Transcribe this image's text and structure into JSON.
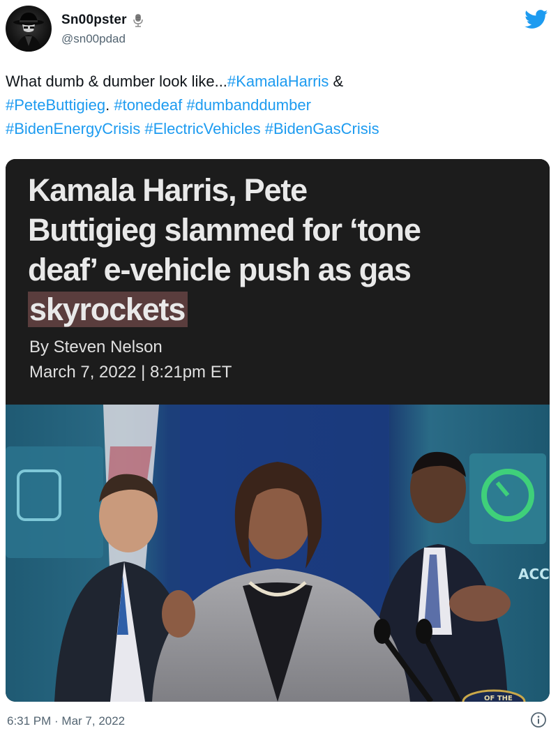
{
  "author": {
    "display_name": "Sn00pster",
    "handle": "@sn00pdad",
    "avatar_icon": "detective-hat-avatar",
    "badge_icon": "microphone-icon"
  },
  "brand": {
    "logo_icon": "twitter-bird-icon",
    "color": "#1d9bf0"
  },
  "tweet": {
    "text_plain_1": "What dumb & dumber look like...",
    "hashtag_kamala": "#KamalaHarris",
    "amp": " & ",
    "hashtag_pete": "#PeteButtigieg",
    "period": ". ",
    "hashtag_tonedeaf": "#tonedeaf",
    "hashtag_dumb": "#dumbanddumber",
    "hashtag_biden_energy": "#BidenEnergyCrisis",
    "hashtag_ev": "#ElectricVehicles",
    "hashtag_biden_gas": "#BidenGasCrisis"
  },
  "article": {
    "headline_line1": "Kamala Harris, Pete",
    "headline_line2": "Buttigieg slammed for ‘tone",
    "headline_line3": "deaf’ e-vehicle push as gas",
    "headline_highlight": "skyrockets",
    "byline": "By Steven Nelson",
    "dateline": "March 7, 2022 | 8:21pm ET",
    "photo_sign_text": "ACC",
    "seal_text": "OF THE"
  },
  "footer": {
    "timestamp": "6:31 PM · Mar 7, 2022",
    "info_icon": "info-icon"
  }
}
